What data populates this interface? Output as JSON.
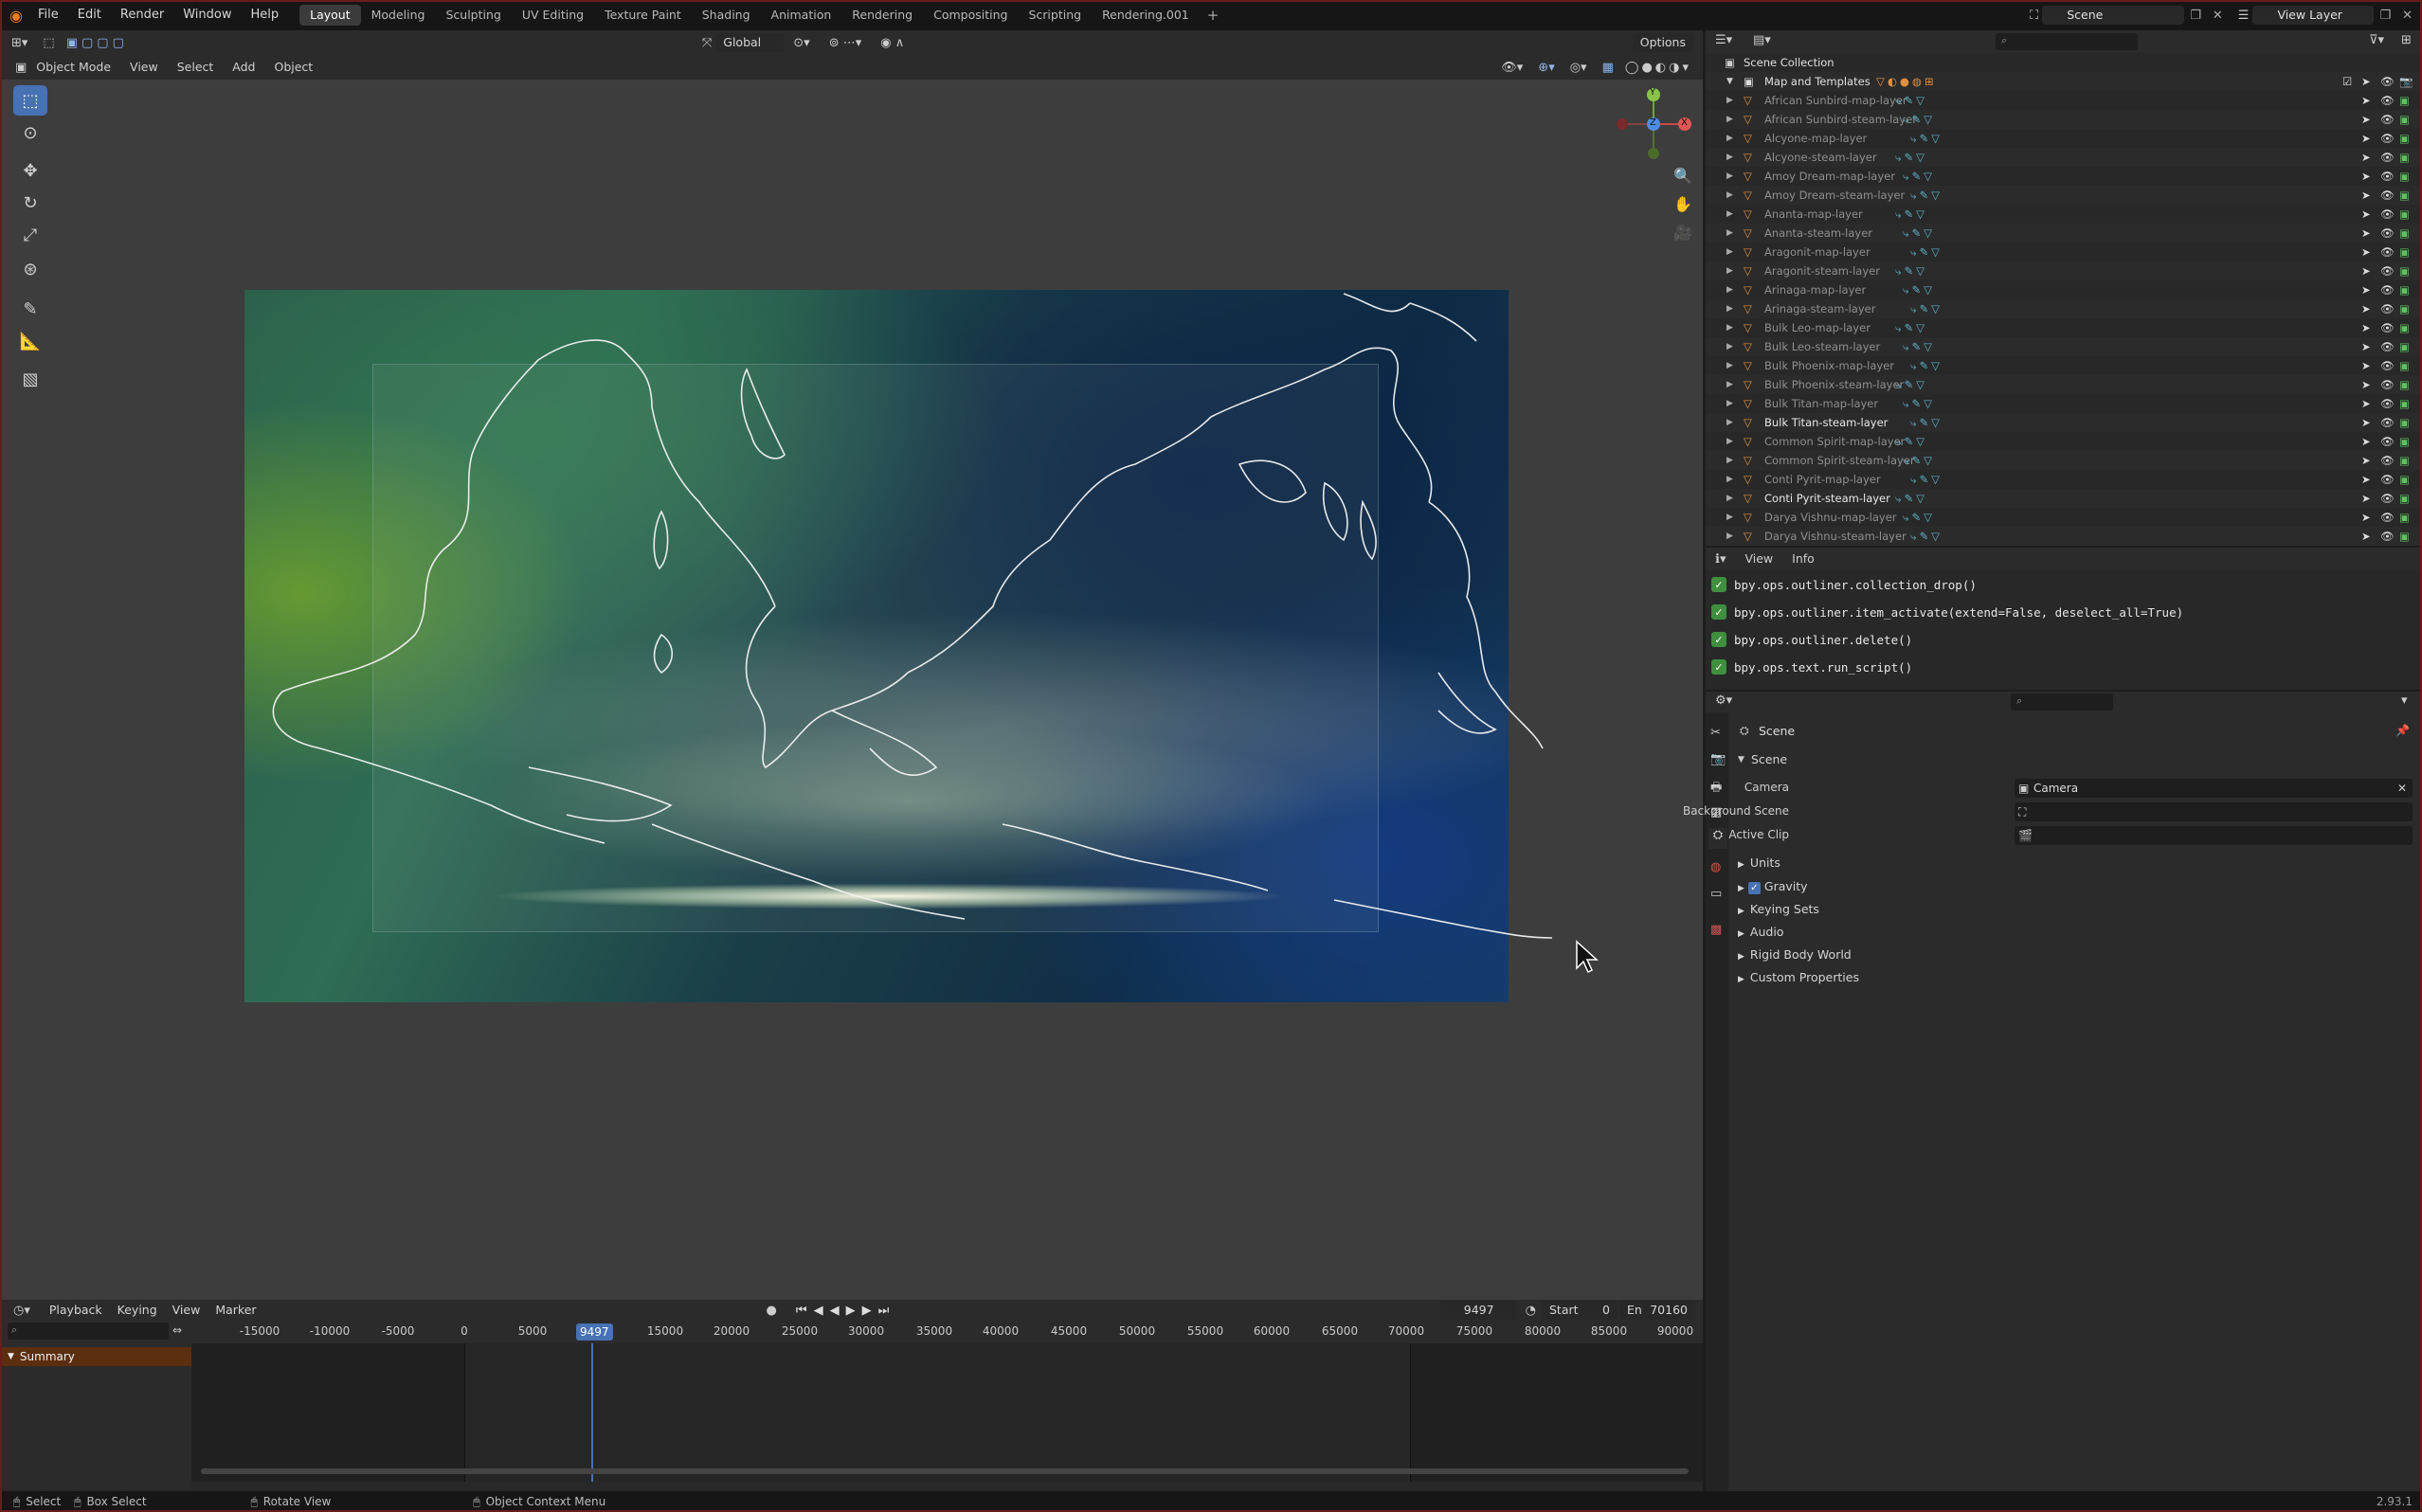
{
  "menubar": {
    "items": [
      "File",
      "Edit",
      "Render",
      "Window",
      "Help"
    ],
    "workspaces": [
      "Layout",
      "Modeling",
      "Sculpting",
      "UV Editing",
      "Texture Paint",
      "Shading",
      "Animation",
      "Rendering",
      "Compositing",
      "Scripting",
      "Rendering.001"
    ],
    "active_workspace": "Layout",
    "scene": "Scene",
    "view_layer": "View Layer"
  },
  "viewport": {
    "transform_orientation": "Global",
    "options_label": "Options",
    "mode": "Object Mode",
    "menu": [
      "View",
      "Select",
      "Add",
      "Object"
    ],
    "gizmo": {
      "x": "X",
      "y": "Y",
      "z": "Z"
    }
  },
  "outliner": {
    "root": "Scene Collection",
    "collection": "Map and Templates",
    "items": [
      {
        "name": "African Sunbird-map-layer",
        "bright": false
      },
      {
        "name": "African Sunbird-steam-layer",
        "bright": false
      },
      {
        "name": "Alcyone-map-layer",
        "bright": false
      },
      {
        "name": "Alcyone-steam-layer",
        "bright": false
      },
      {
        "name": "Amoy Dream-map-layer",
        "bright": false
      },
      {
        "name": "Amoy Dream-steam-layer",
        "bright": false
      },
      {
        "name": "Ananta-map-layer",
        "bright": false
      },
      {
        "name": "Ananta-steam-layer",
        "bright": false
      },
      {
        "name": "Aragonit-map-layer",
        "bright": false
      },
      {
        "name": "Aragonit-steam-layer",
        "bright": false
      },
      {
        "name": "Arinaga-map-layer",
        "bright": false
      },
      {
        "name": "Arinaga-steam-layer",
        "bright": false
      },
      {
        "name": "Bulk Leo-map-layer",
        "bright": false
      },
      {
        "name": "Bulk Leo-steam-layer",
        "bright": false
      },
      {
        "name": "Bulk Phoenix-map-layer",
        "bright": false
      },
      {
        "name": "Bulk Phoenix-steam-layer",
        "bright": false
      },
      {
        "name": "Bulk Titan-map-layer",
        "bright": false
      },
      {
        "name": "Bulk Titan-steam-layer",
        "bright": true
      },
      {
        "name": "Common Spirit-map-layer",
        "bright": false
      },
      {
        "name": "Common Spirit-steam-layer",
        "bright": false
      },
      {
        "name": "Conti Pyrit-map-layer",
        "bright": false
      },
      {
        "name": "Conti Pyrit-steam-layer",
        "bright": true
      },
      {
        "name": "Darya Vishnu-map-layer",
        "bright": false
      },
      {
        "name": "Darya Vishnu-steam-layer",
        "bright": false
      }
    ]
  },
  "info": {
    "menu": [
      "View",
      "Info"
    ],
    "log": [
      "bpy.ops.outliner.collection_drop()",
      "bpy.ops.outliner.item_activate(extend=False, deselect_all=True)",
      "bpy.ops.outliner.delete()",
      "bpy.ops.text.run_script()"
    ]
  },
  "properties": {
    "context": "Scene",
    "section": "Scene",
    "camera_label": "Camera",
    "camera_value": "Camera",
    "background_scene_label": "Background Scene",
    "active_clip_label": "Active Clip",
    "panels": [
      "Units",
      "Gravity",
      "Keying Sets",
      "Audio",
      "Rigid Body World",
      "Custom Properties"
    ]
  },
  "timeline": {
    "menu": [
      "Playback",
      "Keying",
      "View",
      "Marker"
    ],
    "current_frame": "9497",
    "start_label": "Start",
    "start_value": "0",
    "end_label": "En",
    "end_value": "70160",
    "summary": "Summary",
    "ticks": [
      "-15000",
      "-10000",
      "-5000",
      "0",
      "5000",
      "15000",
      "20000",
      "25000",
      "30000",
      "35000",
      "40000",
      "45000",
      "50000",
      "55000",
      "60000",
      "65000",
      "70000",
      "75000",
      "80000",
      "85000",
      "90000"
    ],
    "frame_marker": "9497"
  },
  "statusbar": {
    "select": "Select",
    "box_select": "Box Select",
    "rotate_view": "Rotate View",
    "object_context_menu": "Object Context Menu",
    "version": "2.93.1"
  }
}
